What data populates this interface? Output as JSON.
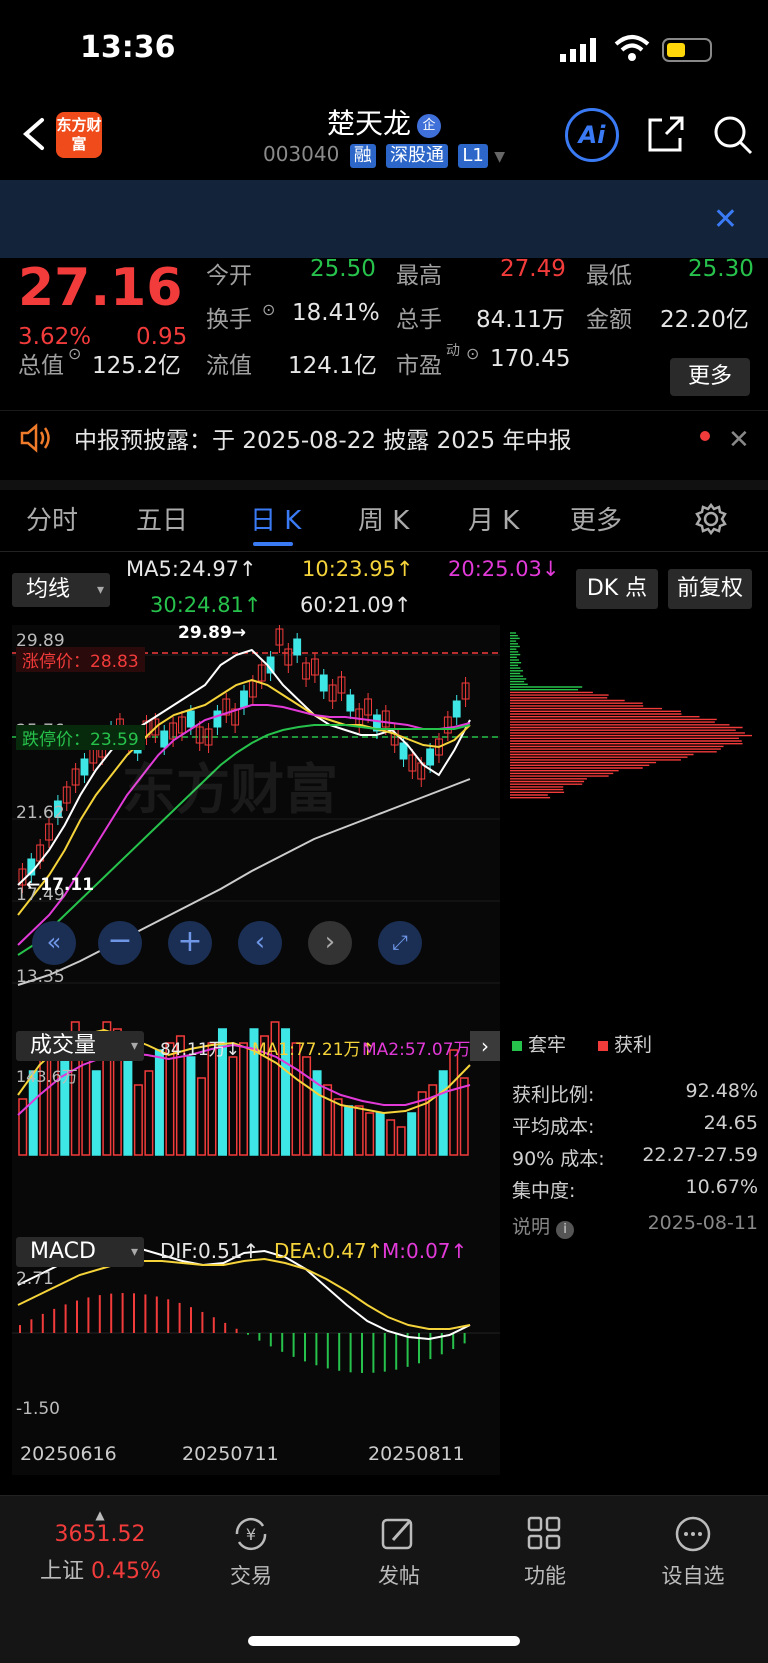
{
  "status": {
    "time": "13:36"
  },
  "header": {
    "logo_text": "东方财富",
    "name": "楚天龙",
    "name_badge": "企",
    "code": "003040",
    "tags": [
      "融",
      "深股通",
      "L1"
    ],
    "ai_label": "Ai"
  },
  "quote": {
    "price": "27.16",
    "change_pct": "3.62%",
    "change": "0.95",
    "fields": [
      {
        "label": "今开",
        "value": "25.50",
        "color": "green"
      },
      {
        "label": "最高",
        "value": "27.49",
        "color": "red"
      },
      {
        "label": "最低",
        "value": "25.30",
        "color": "green"
      },
      {
        "label": "换手",
        "value": "18.41%",
        "color": "white"
      },
      {
        "label": "总手",
        "value": "84.11万",
        "color": "white"
      },
      {
        "label": "金额",
        "value": "22.20亿",
        "color": "white"
      },
      {
        "label": "总值",
        "value": "125.2亿",
        "color": "white"
      },
      {
        "label": "流值",
        "value": "124.1亿",
        "color": "white"
      },
      {
        "label": "市盈",
        "value": "170.45",
        "color": "white"
      }
    ],
    "pe_sup": "动",
    "more_label": "更多"
  },
  "announcement": {
    "text": "中报预披露：于 2025-08-22 披露 2025 年中报"
  },
  "tabs": [
    "分时",
    "五日",
    "日 K",
    "周 K",
    "月 K",
    "更多"
  ],
  "active_tab": 2,
  "ma_panel": {
    "selector": "均线",
    "ma5": "MA5:24.97↑",
    "ma10": "10:23.95↑",
    "ma20": "20:25.03↓",
    "ma30": "30:24.81↑",
    "ma60": "60:21.09↑",
    "dk_label": "DK 点",
    "adjust_label": "前复权"
  },
  "kline": {
    "y_labels": [
      "29.89",
      "25.76",
      "21.62",
      "17.49",
      "13.35"
    ],
    "limit_up": "涨停价：28.83",
    "limit_down": "跌停价：23.59",
    "high_mark": "29.89→",
    "low_mark": "←17.11",
    "watermark": "东方财富"
  },
  "volume_panel": {
    "selector": "成交量",
    "vol": "84.11万↓",
    "ma1": "MA1:77.21万↑",
    "ma2": "MA2:57.07万",
    "y_max": "143.6万"
  },
  "macd_panel": {
    "selector": "MACD",
    "dif": "DIF:0.51↑",
    "dea": "DEA:0.47↑",
    "m": "M:0.07↑",
    "y_top": "2.71",
    "y_bottom": "-1.50",
    "dates": [
      "20250616",
      "20250711",
      "20250811"
    ]
  },
  "chip_legend": {
    "trapped": "套牢",
    "profit": "获利"
  },
  "chip_stats": [
    {
      "label": "获利比例:",
      "value": "92.48%"
    },
    {
      "label": "平均成本:",
      "value": "24.65"
    },
    {
      "label": "90% 成本:",
      "value": "22.27-27.59"
    },
    {
      "label": "集中度:",
      "value": "10.67%"
    },
    {
      "label": "说明",
      "value": "2025-08-11"
    }
  ],
  "bottom_nav": {
    "index_value": "3651.52",
    "index_name": "上证",
    "index_pct": "0.45%",
    "items": [
      "交易",
      "发帖",
      "功能",
      "设自选"
    ]
  },
  "colors": {
    "up": "#f23b3b",
    "down": "#27c24c",
    "accent": "#3a7bf5",
    "cyan": "#3ee6e6"
  }
}
